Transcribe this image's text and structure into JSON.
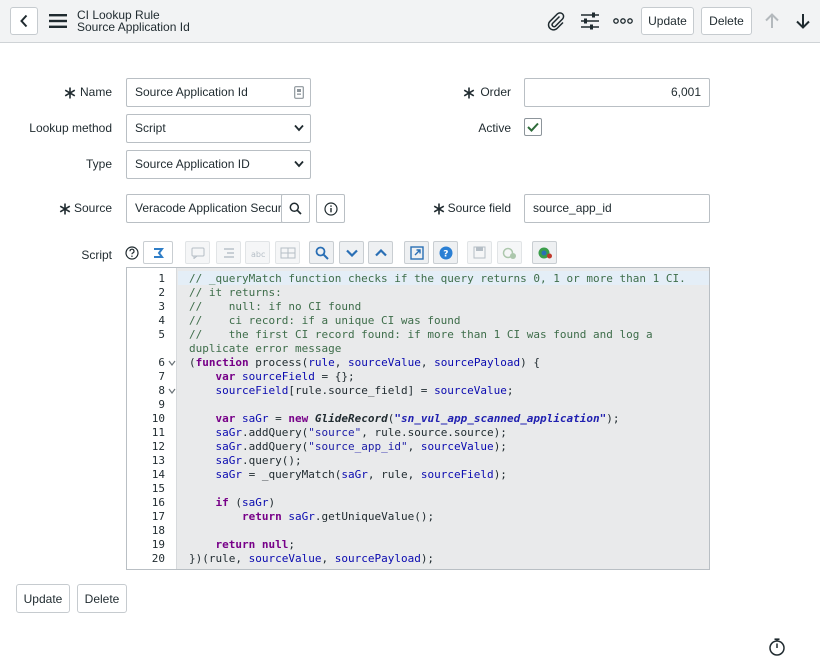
{
  "header": {
    "record_type": "CI Lookup Rule",
    "record_name": "Source Application Id",
    "update_label": "Update",
    "delete_label": "Delete"
  },
  "form": {
    "name": {
      "label": "Name",
      "value": "Source Application Id",
      "required": true
    },
    "order": {
      "label": "Order",
      "value": "6,001",
      "required": true
    },
    "lookup_method": {
      "label": "Lookup method",
      "value": "Script"
    },
    "active": {
      "label": "Active",
      "checked": true
    },
    "type": {
      "label": "Type",
      "value": "Source Application ID"
    },
    "source": {
      "label": "Source",
      "value": "Veracode Application Secur",
      "required": true
    },
    "source_field": {
      "label": "Source field",
      "value": "source_app_id",
      "required": true
    },
    "script": {
      "label": "Script"
    }
  },
  "script": {
    "lines": [
      "// _queryMatch function checks if the query returns 0, 1 or more than 1 CI.",
      "// it returns:",
      "//    null: if no CI found",
      "//    ci record: if a unique CI was found",
      "//    the first CI record found: if more than 1 CI was found and log a",
      "duplicate error message",
      "(function process(rule, sourceValue, sourcePayload) {",
      "    var sourceField = {};",
      "    sourceField[rule.source_field] = sourceValue;",
      "",
      "    var saGr = new GlideRecord(\"sn_vul_app_scanned_application\");",
      "    saGr.addQuery(\"source\", rule.source.source);",
      "    saGr.addQuery(\"source_app_id\", sourceValue);",
      "    saGr.query();",
      "    saGr = _queryMatch(saGr, rule, sourceField);",
      "",
      "    if (saGr)",
      "        return saGr.getUniqueValue();",
      "",
      "    return null;",
      "})(rule, sourceValue, sourcePayload);"
    ],
    "line_numbers": [
      "1",
      "2",
      "3",
      "4",
      "5",
      "",
      "6",
      "7",
      "8",
      "9",
      "10",
      "11",
      "12",
      "13",
      "14",
      "15",
      "16",
      "17",
      "18",
      "19",
      "20"
    ]
  },
  "footer": {
    "update_label": "Update",
    "delete_label": "Delete"
  },
  "icons": {
    "back": "chevron-left-icon",
    "menu": "hamburger-menu-icon",
    "attach": "paperclip-icon",
    "personalize": "sliders-icon",
    "more": "more-options-icon",
    "prev": "arrow-up-icon",
    "next": "arrow-down-icon"
  }
}
